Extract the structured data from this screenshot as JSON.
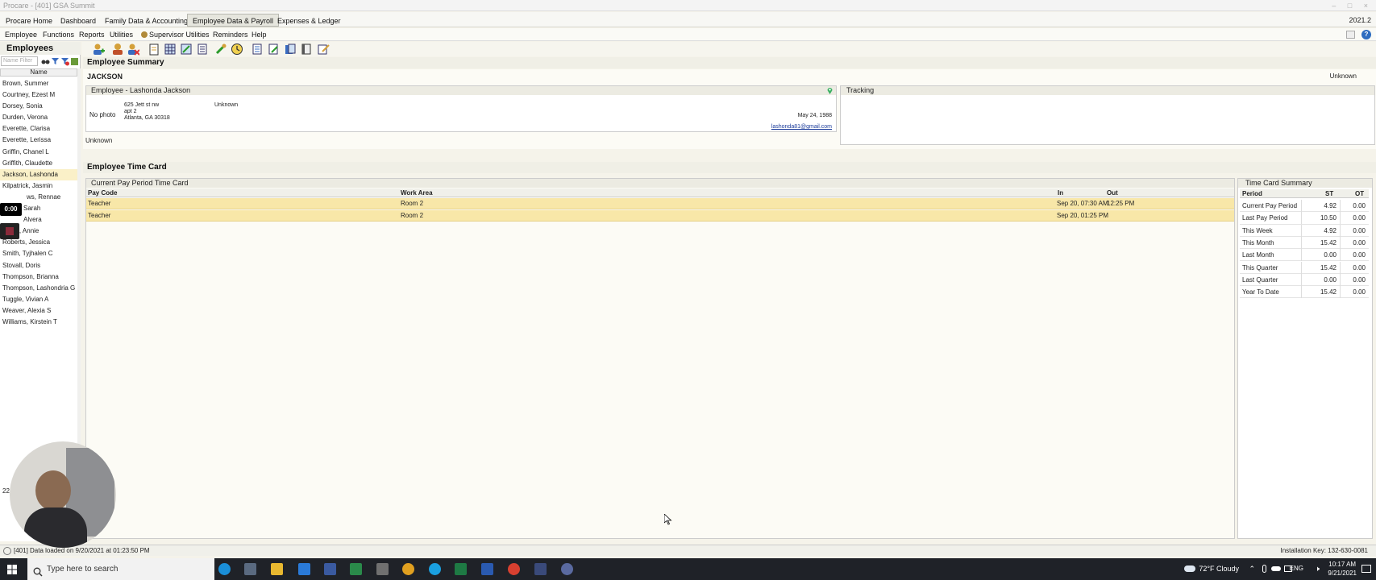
{
  "window": {
    "title": "Procare - [401] GSA Summit",
    "version": "2021.2"
  },
  "main_tabs": [
    "Procare Home",
    "Dashboard",
    "Family Data & Accounting",
    "Employee Data & Payroll",
    "Expenses & Ledger"
  ],
  "menu": {
    "employee": "Employee",
    "functions": "Functions",
    "reports": "Reports",
    "utilities": "Utilities",
    "supervisor": "Supervisor Utilities",
    "reminders": "Reminders",
    "help": "Help"
  },
  "left_panel": {
    "title": "Employees",
    "filter_placeholder": "Name Filter",
    "column_header": "Name",
    "employees": [
      "Brown, Summer",
      "Courtney, Ezest M",
      "Dorsey, Sonia",
      "Durden, Verona",
      "Everette, Clarisa",
      "Everette, Lerissa",
      "Griffin, Chanel L",
      "Griffith, Claudette",
      "Jackson, Lashonda",
      "Kilpatrick, Jasmin",
      "ws, Rennae",
      "Sarah",
      "Alvera",
      "Pyron, Annie",
      "Roberts, Jessica",
      "Smith, Tyjhalen C",
      "Stovall, Doris",
      "Thompson, Brianna",
      "Thompson, Lashondria G",
      "Tuggle, Vivian A",
      "Weaver, Alexia S",
      "Williams, Kirstein T"
    ],
    "selected": "Jackson, Lashonda",
    "count_label": "22 Employe"
  },
  "summary": {
    "title": "Employee Summary",
    "last_name": "JACKSON",
    "status_right": "Unknown",
    "employee_box_title": "Employee - Lashonda Jackson",
    "photo_label": "No photo",
    "address_line1": "625 Jett st nw",
    "address_line2": "apt 2",
    "address_line3": "Atlanta, GA  30318",
    "middle_value": "Unknown",
    "dob": "May 24, 1988",
    "email": "lashonda81@gmail.com",
    "bottom_status": "Unknown",
    "tracking_title": "Tracking"
  },
  "timecard": {
    "title": "Employee Time Card",
    "current_title": "Current Pay Period Time Card",
    "columns": {
      "pay_code": "Pay Code",
      "work_area": "Work Area",
      "in": "In",
      "out": "Out"
    },
    "rows": [
      {
        "pay_code": "Teacher",
        "work_area": "Room 2",
        "in": "Sep 20, 07:30 AM",
        "out": "12:25 PM"
      },
      {
        "pay_code": "Teacher",
        "work_area": "Room 2",
        "in": "Sep 20, 01:25 PM",
        "out": ""
      }
    ]
  },
  "summary_card": {
    "title": "Time Card Summary",
    "columns": {
      "period": "Period",
      "st": "ST",
      "ot": "OT"
    },
    "rows": [
      {
        "period": "Current Pay Period",
        "st": "4.92",
        "ot": "0.00"
      },
      {
        "period": "Last Pay Period",
        "st": "10.50",
        "ot": "0.00"
      },
      {
        "period": "This Week",
        "st": "4.92",
        "ot": "0.00"
      },
      {
        "period": "This Month",
        "st": "15.42",
        "ot": "0.00"
      },
      {
        "period": "Last Month",
        "st": "0.00",
        "ot": "0.00"
      },
      {
        "period": "This Quarter",
        "st": "15.42",
        "ot": "0.00"
      },
      {
        "period": "Last Quarter",
        "st": "0.00",
        "ot": "0.00"
      },
      {
        "period": "Year To Date",
        "st": "15.42",
        "ot": "0.00"
      }
    ]
  },
  "status": {
    "text": "[401] Data loaded on 9/20/2021 at 01:23:50 PM",
    "install_key": "Installation Key: 132-630-0081"
  },
  "taskbar": {
    "search_placeholder": "Type here to search",
    "weather": "72°F  Cloudy",
    "lang": "ENG",
    "time": "10:17 AM",
    "date": "9/21/2021"
  },
  "overlay": {
    "timer": "0:00"
  },
  "colors": {
    "selected_row": "#f8e7a8",
    "panel_bg": "#f5f3ea",
    "taskbar": "#1f2228",
    "link": "#1a3a9a"
  }
}
